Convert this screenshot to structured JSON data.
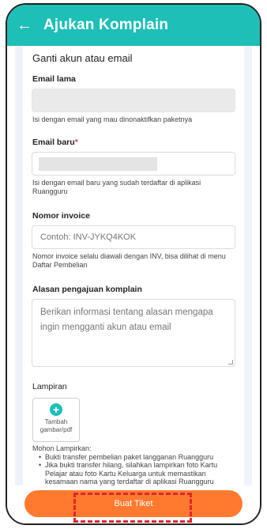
{
  "app_bar": {
    "back_icon": "arrow-left-icon",
    "title": "Ajukan Komplain"
  },
  "form": {
    "section_title": "Ganti akun atau email",
    "old_email": {
      "label": "Email lama",
      "help": "Isi dengan email yang mau dinonaktifkan paketnya"
    },
    "new_email": {
      "label": "Email baru",
      "required_mark": "*",
      "help": "Isi dengan email baru yang sudah terdaftar di aplikasi Ruangguru"
    },
    "invoice": {
      "label": "Nomor invoice",
      "placeholder": "Contoh: INV-JYKQ4KOK",
      "help": "Nomor invoice selalu diawali dengan INV, bisa dilihat di menu Daftar Pembelian"
    },
    "reason": {
      "label": "Alasan pengajuan komplain",
      "placeholder": "Berikan informasi tentang alasan mengapa ingin mengganti akun atau email"
    },
    "attachment": {
      "label": "Lampiran",
      "upload_icon": "plus-circle-icon",
      "upload_line1": "Tambah",
      "upload_line2": "gambar/pdf",
      "notes_title": "Mohon Lampirkan:",
      "notes": [
        "Bukti transfer pembelian paket langganan Ruangguru",
        "Jika bukti transfer hilang, silahkan lampirkan foto Kartu Pelajar atau foto Kartu Keluarga untuk memastikan kesamaan nama yang terdaftar di aplikasi Ruangguru"
      ]
    }
  },
  "submit_button": "Buat Tiket",
  "colors": {
    "primary": "#1dbfb7",
    "cta": "#ff7a2f",
    "highlight": "#e0262a"
  }
}
